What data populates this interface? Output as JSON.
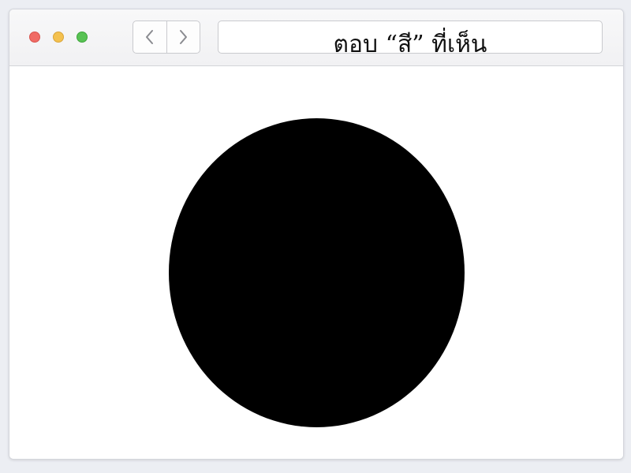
{
  "window": {
    "controls": [
      "close",
      "minimize",
      "maximize"
    ]
  },
  "toolbar": {
    "back_icon": "chevron-left-icon",
    "forward_icon": "chevron-right-icon"
  },
  "address_bar": {
    "text": "ตอบ “สี” ที่เห็น"
  },
  "content": {
    "shape": "circle",
    "shape_color": "#000000"
  },
  "colors": {
    "close": "#f06b65",
    "minimize": "#f4c14f",
    "maximize": "#58c254"
  }
}
